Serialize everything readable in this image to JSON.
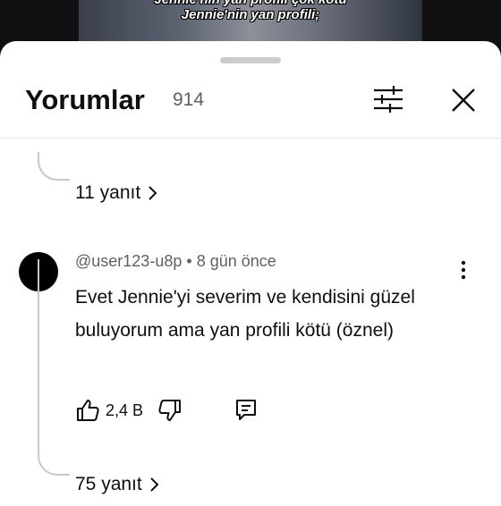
{
  "video": {
    "caption_line1": "Jennie'nin yan profili çok kötü",
    "caption_line2": "Jennie'nin yan profili;"
  },
  "header": {
    "title": "Yorumlar",
    "count": "914",
    "icons": {
      "filter": "filter-sliders-icon",
      "close": "close-icon"
    }
  },
  "thread": {
    "previous_replies_label": "11 yanıt"
  },
  "comment": {
    "author": "@user123-u8p",
    "separator": "•",
    "time": "8 gün önce",
    "text": "Evet Jennie'yi severim ve kendisini güzel buluyorum ama yan profili kötü (öznel)",
    "likes": "2,4 B",
    "replies_label": "75 yanıt",
    "icons": {
      "more": "more-vert-icon",
      "like": "thumbs-up-icon",
      "dislike": "thumbs-down-icon",
      "reply": "reply-comment-icon"
    }
  },
  "colors": {
    "sheet_bg": "#ffffff",
    "text": "#0f0f0f",
    "secondary_text": "#606060",
    "thread_line": "#c8c8c8"
  }
}
